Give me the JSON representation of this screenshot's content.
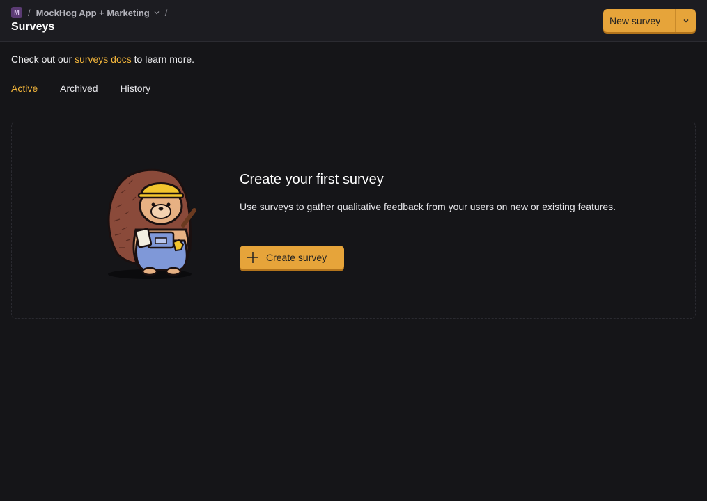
{
  "breadcrumb": {
    "project_badge": "M",
    "separator": "/",
    "project_name": "MockHog App + Marketing"
  },
  "header": {
    "title": "Surveys",
    "new_survey_label": "New survey"
  },
  "intro": {
    "prefix": "Check out our ",
    "link": "surveys docs",
    "suffix": " to learn more."
  },
  "tabs": [
    {
      "label": "Active",
      "active": true
    },
    {
      "label": "Archived",
      "active": false
    },
    {
      "label": "History",
      "active": false
    }
  ],
  "empty_state": {
    "title": "Create your first survey",
    "description": "Use surveys to gather qualitative feedback from your users on new or existing features.",
    "button_label": "Create survey"
  },
  "colors": {
    "accent": "#f2b53b",
    "button": "#e6a43a",
    "background": "#151518"
  },
  "icons": {
    "breadcrumb_chevron": "chevron-down-icon",
    "new_survey_dropdown": "chevron-down-icon",
    "create_button": "plus-icon",
    "illustration": "hedgehog-builder-illustration"
  }
}
